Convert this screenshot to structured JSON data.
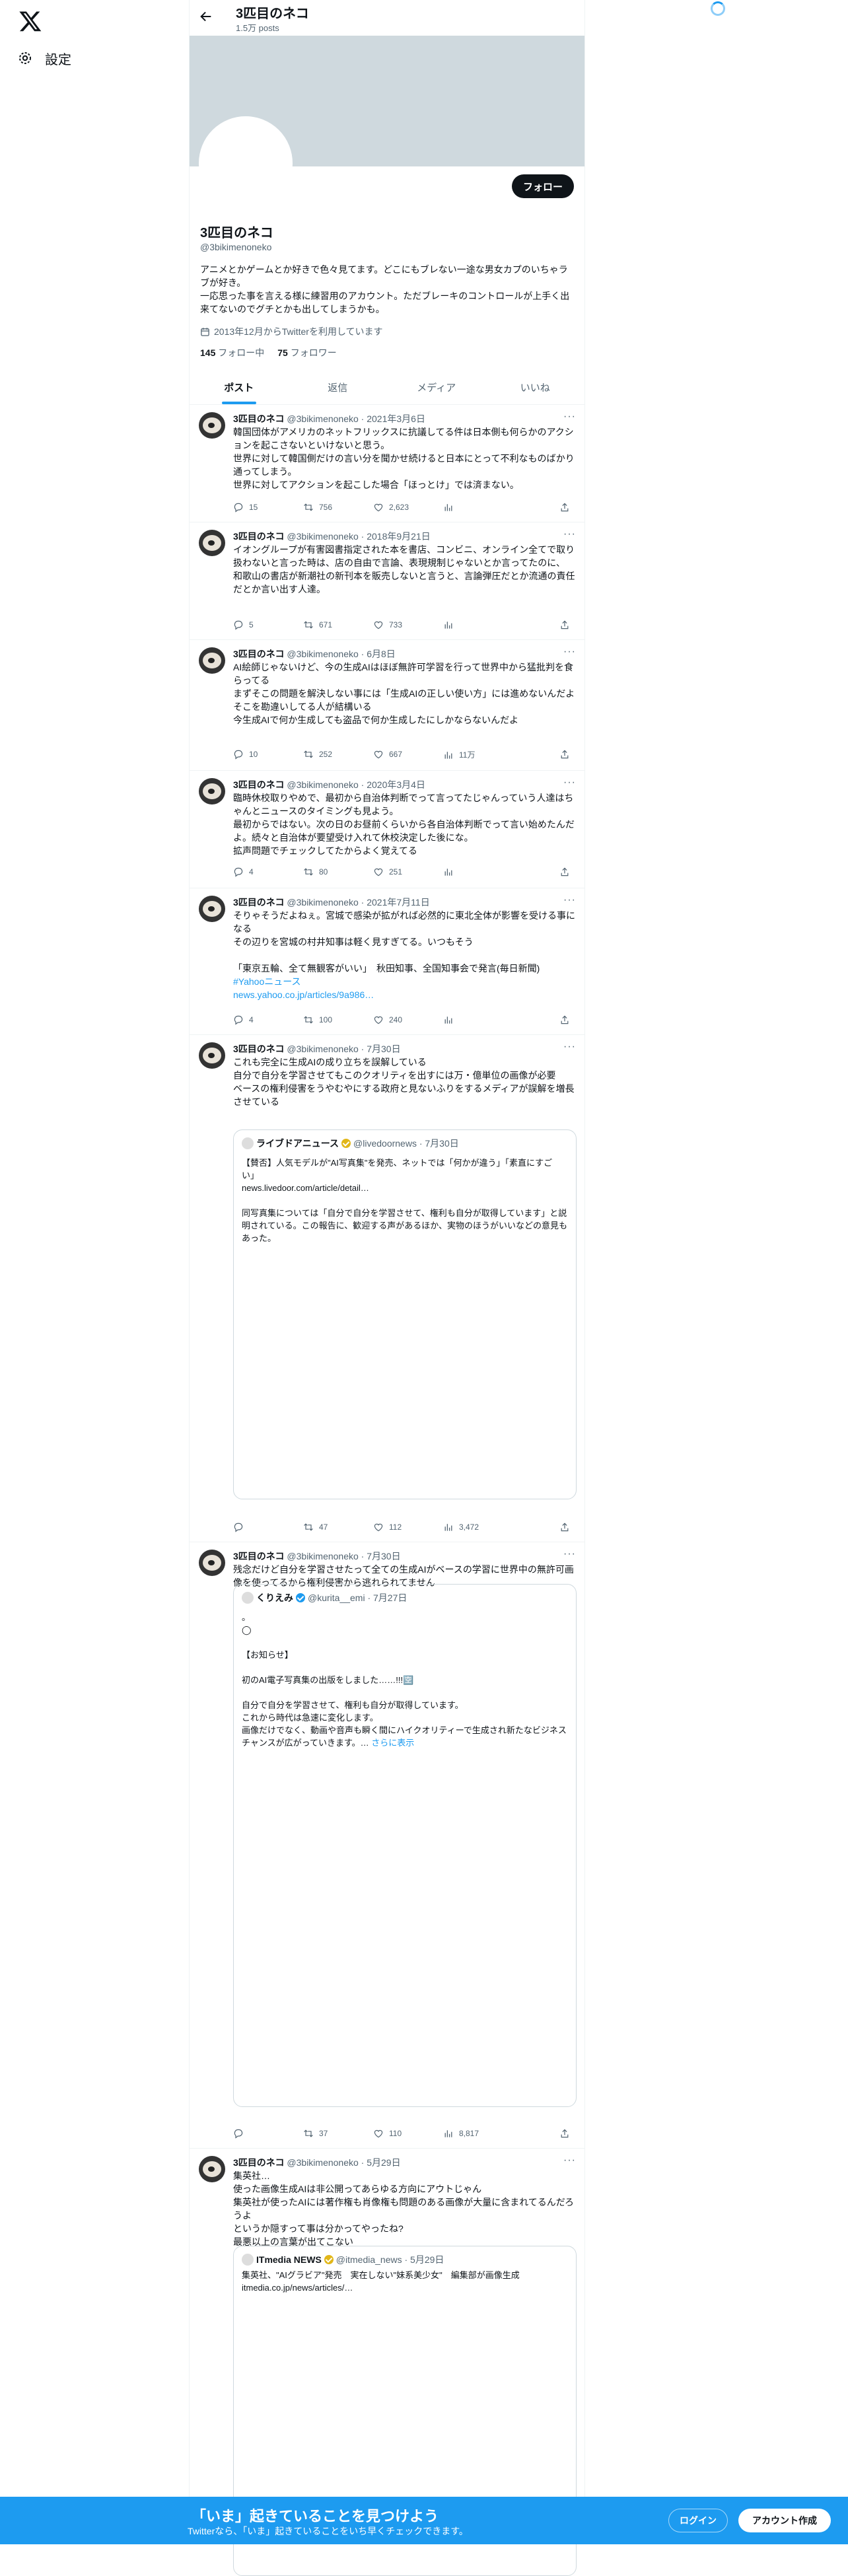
{
  "nav": {
    "settings_label": "設定"
  },
  "header": {
    "name": "3匹目のネコ",
    "posts": "1.5万 posts"
  },
  "profile": {
    "follow_label": "フォロー",
    "name": "3匹目のネコ",
    "handle": "@3bikimenoneko",
    "bio": "アニメとかゲームとか好きで色々見てます。どこにもブレない一途な男女カプのいちゃラブが好き。\n一応思った事を言える様に練習用のアカウント。ただブレーキのコントロールが上手く出来てないのでグチとかも出してしまうかも。",
    "joined": "2013年12月からTwitterを利用しています",
    "following_count": "145",
    "following_label": "フォロー中",
    "followers_count": "75",
    "followers_label": "フォロワー"
  },
  "tabs": [
    "ポスト",
    "返信",
    "メディア",
    "いいね"
  ],
  "tweets": [
    {
      "name": "3匹目のネコ",
      "meta": "@3bikimenoneko · 2021年3月6日",
      "text": "韓国団体がアメリカのネットフリックスに抗議してる件は日本側も何らかのアクションを起こさないといけないと思う。\n世界に対して韓国側だけの言い分を聞かせ続けると日本にとって不利なものばかり通ってしまう。\n世界に対してアクションを起こした場合「ほっとけ」では済まない。",
      "replies": "15",
      "retweets": "756",
      "likes": "2,623",
      "views": ""
    },
    {
      "name": "3匹目のネコ",
      "meta": "@3bikimenoneko · 2018年9月21日",
      "text": "イオングループが有害図書指定された本を書店、コンビニ、オンライン全てで取り扱わないと言った時は、店の自由で言論、表現規制じゃないとか言ってたのに、\n和歌山の書店が新潮社の新刊本を販売しないと言うと、言論弾圧だとか流通の責任だとか言い出す人達。",
      "replies": "5",
      "retweets": "671",
      "likes": "733",
      "views": ""
    },
    {
      "name": "3匹目のネコ",
      "meta": "@3bikimenoneko · 6月8日",
      "text": "AI絵師じゃないけど、今の生成AIはほぼ無許可学習を行って世界中から猛批判を食らってる\nまずそこの問題を解決しない事には「生成AIの正しい使い方」には進めないんだよ\nそこを勘違いしてる人が結構いる\n今生成AIで何か生成しても盗品で何か生成したにしかならないんだよ",
      "replies": "10",
      "retweets": "252",
      "likes": "667",
      "views": "11万"
    },
    {
      "name": "3匹目のネコ",
      "meta": "@3bikimenoneko · 2020年3月4日",
      "text": "臨時休校取りやめで、最初から自治体判断でって言ってたじゃんっていう人達はちゃんとニュースのタイミングも見よう。\n最初からではない。次の日のお昼前くらいから各自治体判断でって言い始めたんだよ。続々と自治体が要望受け入れて休校決定した後にな。\n拡声問題でチェックしてたからよく覚えてる",
      "replies": "4",
      "retweets": "80",
      "likes": "251",
      "views": ""
    },
    {
      "name": "3匹目のネコ",
      "meta": "@3bikimenoneko · 2021年7月11日",
      "text": "そりゃそうだよねぇ。宮城で感染が拡がれば必然的に東北全体が影響を受ける事になる\nその辺りを宮城の村井知事は軽く見すぎてる。いつもそう\n\n「東京五輪、全て無観客がいい」　秋田知事、全国知事会で発言(毎日新聞)",
      "tag": "#Yahooニュース",
      "url": "news.yahoo.co.jp/articles/9a986…",
      "replies": "4",
      "retweets": "100",
      "likes": "240",
      "views": ""
    },
    {
      "name": "3匹目のネコ",
      "meta": "@3bikimenoneko · 7月30日",
      "text": "これも完全に生成AIの成り立ちを誤解している\n自分で自分を学習させてもこのクオリティを出すには万・億単位の画像が必要\nベースの権利侵害をうやむやにする政府と見ないふりをするメディアが誤解を増長させている",
      "quote": {
        "name": "ライブドアニュース",
        "meta": "@livedoornews · 7月30日",
        "text": "【賛否】人気モデルが\"AI写真集\"を発売、ネットでは「何かが違う」「素直にすごい」\nnews.livedoor.com/article/detail…\n\n同写真集については「自分で自分を学習させて、権利も自分が取得しています」と説明されている。この報告に、歓迎する声があるほか、実物のほうがいいなどの意見もあった。"
      },
      "replies": "",
      "retweets": "47",
      "likes": "112",
      "views": "3,472"
    },
    {
      "name": "3匹目のネコ",
      "meta": "@3bikimenoneko · 7月30日",
      "text": "残念だけど自分を学習させたって全ての生成AIがベースの学習に世界中の無許可画像を使ってるから権利侵害から逃れられてません",
      "quote": {
        "name": "くりえみ",
        "meta": "@kurita__emi · 7月27日",
        "text": "。\n◯\n\n【お知らせ】\n\n初のAI電子写真集の出版をしました……!!!🈳\n\n自分で自分を学習させて、権利も自分が取得しています。\nこれから時代は急速に変化します。\n画像だけでなく、動画や音声も瞬く間にハイクオリティーで生成され新たなビジネスチャンスが広がっていきます。… ",
        "more": "さらに表示"
      },
      "replies": "",
      "retweets": "37",
      "likes": "110",
      "views": "8,817"
    },
    {
      "name": "3匹目のネコ",
      "meta": "@3bikimenoneko · 5月29日",
      "text": "集英社…\n使った画像生成AIは非公開ってあらゆる方向にアウトじゃん\n集英社が使ったAIには著作権も肖像権も問題のある画像が大量に含まれてるんだろうよ\nというか隠すって事は分かってやったね?\n最悪以上の言葉が出てこない",
      "quote": {
        "name": "ITmedia NEWS",
        "meta": "@itmedia_news · 5月29日",
        "text": "集英社、\"AIグラビア\"発売　実在しない\"妹系美少女\"　編集部が画像生成itmedia.co.jp/news/articles/…"
      },
      "replies": "",
      "retweets": "",
      "likes": "",
      "views": ""
    }
  ],
  "bottom": {
    "title": "「いま」起きていることを見つけよう",
    "subtitle": "Twitterなら、「いま」起きていることをいち早くチェックできます。",
    "login": "ログイン",
    "signup": "アカウント作成"
  },
  "colors": {
    "accent": "#1d9bf0",
    "text": "#0f1419",
    "muted": "#536471",
    "banner": "#cfd9de"
  }
}
